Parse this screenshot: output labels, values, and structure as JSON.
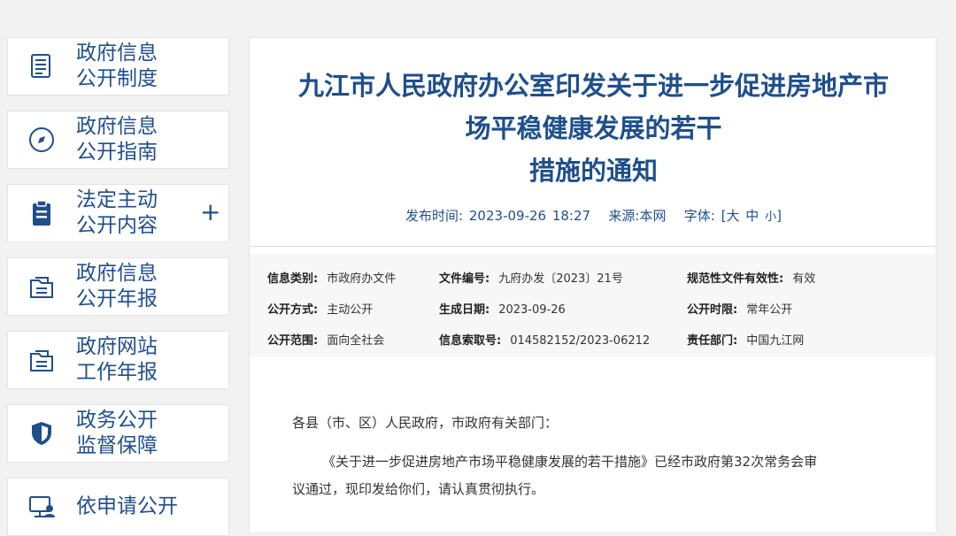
{
  "sidebar": {
    "items": [
      {
        "label": "政府信息\n公开制度",
        "icon": "document-list-icon"
      },
      {
        "label": "政府信息\n公开指南",
        "icon": "compass-icon"
      },
      {
        "label": "法定主动\n公开内容",
        "icon": "clipboard-icon",
        "expand": "+"
      },
      {
        "label": "政府信息\n公开年报",
        "icon": "folder-report-icon"
      },
      {
        "label": "政府网站\n工作年报",
        "icon": "folder-report-icon"
      },
      {
        "label": "政务公开\n监督保障",
        "icon": "shield-icon"
      },
      {
        "label": "依申请公开",
        "icon": "computer-user-icon"
      }
    ]
  },
  "article": {
    "title": "九江市人民政府办公室印发关于进一步促进房地产市\n场平稳健康发展的若干\n措施的通知",
    "publish_label": "发布时间:",
    "publish_time": "2023-09-26 18:27",
    "source_label": "来源:",
    "source": "本网",
    "font_label": "字体:",
    "font_open": "[",
    "font_large": "大",
    "font_medium": "中",
    "font_small": "小",
    "font_close": "]"
  },
  "meta": [
    {
      "key": "信息类别:",
      "value": "市政府办文件"
    },
    {
      "key": "文件编号:",
      "value": "九府办发〔2023〕21号"
    },
    {
      "key": "规范性文件有效性:",
      "value": "有效"
    },
    {
      "key": "公开方式:",
      "value": "主动公开"
    },
    {
      "key": "生成日期:",
      "value": "2023-09-26"
    },
    {
      "key": "公开时限:",
      "value": "常年公开"
    },
    {
      "key": "公开范围:",
      "value": "面向全社会"
    },
    {
      "key": "信息索取号:",
      "value": "014582152/2023-06212"
    },
    {
      "key": "责任部门:",
      "value": "中国九江网"
    }
  ],
  "body": {
    "salutation": "各县（市、区）人民政府，市政府有关部门：",
    "para1_line1": "《关于进一步促进房地产市场平稳健康发展的若干措施》已经市政府第32次常务会审",
    "para1_line2": "议通过，现印发给你们，请认真贯彻执行。"
  },
  "colors": {
    "accent": "#1f4f8b",
    "background": "#f2f2f2",
    "meta_bg": "#f7f7f7"
  }
}
